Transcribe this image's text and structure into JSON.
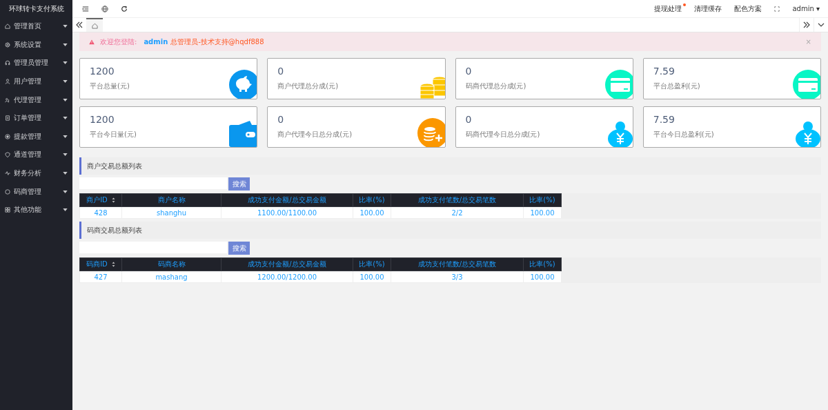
{
  "sidebar": {
    "title": "环球转卡支付系统",
    "items": [
      {
        "label": "管理首页"
      },
      {
        "label": "系统设置"
      },
      {
        "label": "管理员管理"
      },
      {
        "label": "用户管理"
      },
      {
        "label": "代理管理"
      },
      {
        "label": "订单管理"
      },
      {
        "label": "提款管理"
      },
      {
        "label": "通道管理"
      },
      {
        "label": "财务分析"
      },
      {
        "label": "码商管理"
      },
      {
        "label": "其他功能"
      }
    ]
  },
  "topbar": {
    "links": [
      {
        "label": "提现处理",
        "dot": true
      },
      {
        "label": "清理缓存",
        "dot": false
      },
      {
        "label": "配色方案",
        "dot": false
      }
    ],
    "user": "admin ▾"
  },
  "tabs": [
    {
      "kind": "home",
      "selected": true
    }
  ],
  "alert": {
    "prefix": "欢迎您登陆:",
    "user": "admin",
    "role": "总管理员-技术支持@hqdf888",
    "close": "×"
  },
  "cards": [
    {
      "value": "1200",
      "label": "平台总量(元)",
      "kind": "piggy"
    },
    {
      "value": "0",
      "label": "商户代理总分成(元)",
      "kind": "coins"
    },
    {
      "value": "0",
      "label": "码商代理总分成(元)",
      "kind": "card"
    },
    {
      "value": "7.59",
      "label": "平台总盈利(元)",
      "kind": "card"
    },
    {
      "value": "1200",
      "label": "平台今日量(元)",
      "kind": "wallet"
    },
    {
      "value": "0",
      "label": "商户代理今日总分成(元)",
      "kind": "coinplus"
    },
    {
      "value": "0",
      "label": "码商代理今日总分成(元)",
      "kind": "moneybag"
    },
    {
      "value": "7.59",
      "label": "平台今日总盈利(元)",
      "kind": "moneybag"
    }
  ],
  "sections": [
    {
      "title": "商户交易总额列表",
      "search_button": "搜索",
      "columns": [
        "商户ID",
        "商户名称",
        "成功支付金额/总交易金额",
        "比率(%)",
        "成功支付笔数/总交易笔数",
        "比率(%)"
      ],
      "rows": [
        [
          "428",
          "shanghu",
          "1100.00/1100.00",
          "100.00",
          "2/2",
          "100.00"
        ]
      ]
    },
    {
      "title": "码商交易总额列表",
      "search_button": "搜索",
      "columns": [
        "码商ID",
        "码商名称",
        "成功支付金额/总交易金额",
        "比率(%)",
        "成功支付笔数/总交易笔数",
        "比率(%)"
      ],
      "rows": [
        [
          "427",
          "mashang",
          "1200.00/1200.00",
          "100.00",
          "3/3",
          "100.00"
        ]
      ]
    }
  ]
}
